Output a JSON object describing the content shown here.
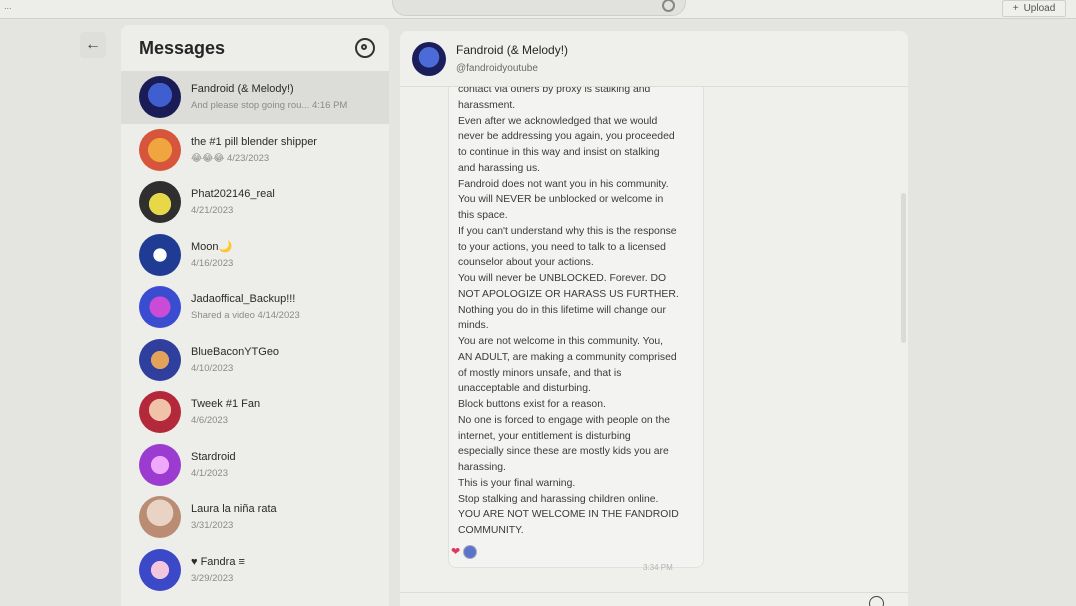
{
  "topbar": {
    "left_text": "...",
    "upload_label": "Upload",
    "upload_icon": "plus-icon"
  },
  "messages": {
    "title": "Messages",
    "settings_icon": "gear-icon",
    "back_icon": "arrow-left-icon",
    "conversations": [
      {
        "name": "Fandroid (& Melody!)",
        "subtitle": "And please stop going rou...",
        "time": "4:16 PM",
        "active": true
      },
      {
        "name": "the #1 pill blender shipper",
        "subtitle": "😂😂😂 4/23/2023"
      },
      {
        "name": "Phat202146_real",
        "subtitle": "4/21/2023"
      },
      {
        "name": "Moon🌙",
        "subtitle": "4/16/2023"
      },
      {
        "name": "Jadaoffical_Backup!!!",
        "subtitle": "Shared a video 4/14/2023"
      },
      {
        "name": "BlueBaconYTGeo",
        "subtitle": "4/10/2023"
      },
      {
        "name": "Tweek #1 Fan",
        "subtitle": "4/6/2023"
      },
      {
        "name": "Stardroid",
        "subtitle": "4/1/2023"
      },
      {
        "name": "Laura la niña rata",
        "subtitle": "3/31/2023"
      },
      {
        "name": "♥ Fandra ≡",
        "subtitle": "3/29/2023"
      }
    ]
  },
  "chat": {
    "name": "Fandroid (& Melody!)",
    "handle": "@fandroidyoutube",
    "message_lines": [
      "contact via others by proxy is stalking and",
      "harassment.",
      "Even after we acknowledged that we would",
      "never be addressing you again, you proceeded",
      "to continue in this way and insist on stalking",
      "and harassing us.",
      "Fandroid does not want you in his community.",
      "You will NEVER be unblocked or welcome in",
      "this space.",
      "If you can't understand why this is the response",
      "to your actions, you need to talk to a licensed",
      "counselor about your actions.",
      "You will never be UNBLOCKED. Forever. DO",
      "NOT APOLOGIZE OR HARASS US FURTHER.",
      "Nothing you do in this lifetime will change our",
      "minds.",
      "You are not welcome in this community. You,",
      "AN ADULT, are making a community comprised",
      "of mostly minors unsafe, and that is",
      "unacceptable and disturbing.",
      "Block buttons exist for a reason.",
      "No one is forced to engage with people on the",
      "internet, your entitlement is disturbing",
      "especially since these are mostly kids you are",
      "harassing.",
      "This is your final warning.",
      "Stop stalking and harassing children online.",
      "YOU ARE NOT WELCOME IN THE FANDROID",
      "COMMUNITY."
    ],
    "reactions": [
      "❤"
    ],
    "time": "3:34 PM",
    "emoji_icon": "smiley-icon"
  }
}
